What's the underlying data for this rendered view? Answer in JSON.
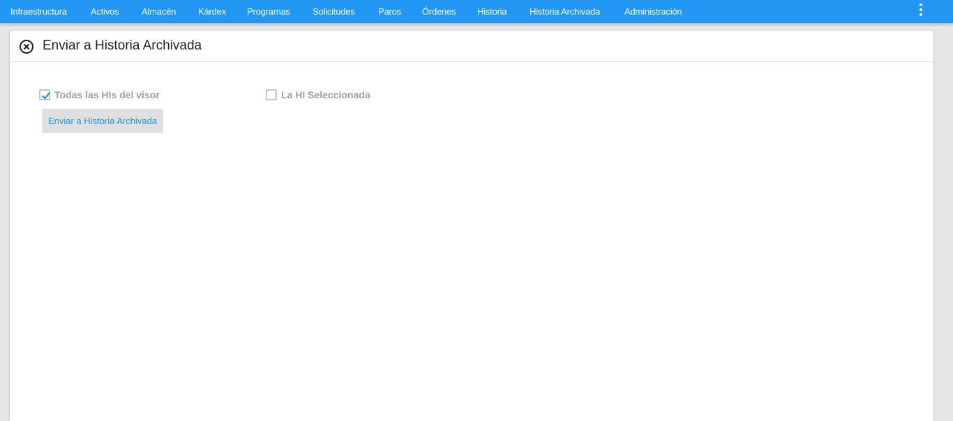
{
  "nav": {
    "items": [
      {
        "label": "Infraestructura"
      },
      {
        "label": "Activos"
      },
      {
        "label": "Almacén"
      },
      {
        "label": "Kárdex"
      },
      {
        "label": "Programas"
      },
      {
        "label": "Solicitudes"
      },
      {
        "label": "Paros"
      },
      {
        "label": "Órdenes"
      },
      {
        "label": "Historia"
      },
      {
        "label": "Historia Archivada"
      },
      {
        "label": "Administración"
      }
    ],
    "menu_icon": "more-vert-icon",
    "accent_color": "#2196f3"
  },
  "dialog": {
    "title": "Enviar a Historia Archivada",
    "close_icon": "close-circle-icon",
    "options": [
      {
        "label": "Todas las HIs del visor",
        "checked": true
      },
      {
        "label": "La HI Seleccionada",
        "checked": false
      }
    ],
    "submit_label": "Enviar a Historia Archivada"
  }
}
